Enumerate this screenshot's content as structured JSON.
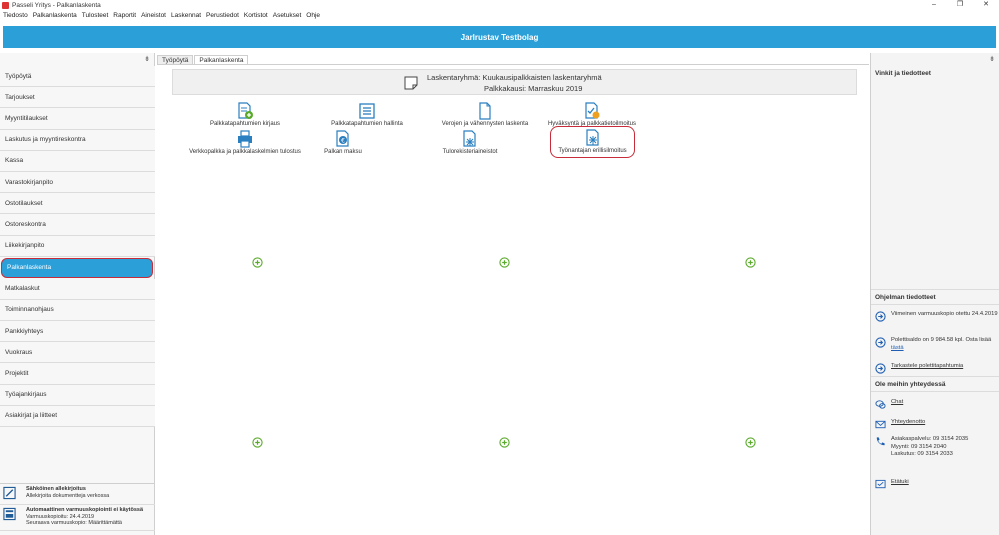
{
  "window": {
    "title": "Passeli Yritys - Palkanlaskenta"
  },
  "menu": [
    "Tiedosto",
    "Palkanlaskenta",
    "Tulosteet",
    "Raportit",
    "Aineistot",
    "Laskennat",
    "Perustiedot",
    "Kortistot",
    "Asetukset",
    "Ohje"
  ],
  "banner": {
    "company": "Jarlrustav Testbolag"
  },
  "sidebar": {
    "items": [
      {
        "label": "Työpöytä"
      },
      {
        "label": "Tarjoukset"
      },
      {
        "label": "Myyntitilaukset"
      },
      {
        "label": "Laskutus ja myyntireskontra"
      },
      {
        "label": "Kassa"
      },
      {
        "label": "Varastokirjanpito"
      },
      {
        "label": "Ostotilaukset"
      },
      {
        "label": "Ostoreskontra"
      },
      {
        "label": "Liikekirjanpito"
      },
      {
        "label": "Palkanlaskenta"
      },
      {
        "label": "Matkalaskut"
      },
      {
        "label": "Toiminnanohjaus"
      },
      {
        "label": "Pankkiyhteys"
      },
      {
        "label": "Vuokraus"
      },
      {
        "label": "Projektit"
      },
      {
        "label": "Työajankirjaus"
      },
      {
        "label": "Asiakirjat ja liitteet"
      }
    ],
    "active_index": 9,
    "bottom": {
      "esign_title": "Sähköinen allekirjoitus",
      "esign_sub": "Allekirjoita dokumentteja verkossa",
      "backup_title": "Automaattinen varmuuskopiointi ei käytössä",
      "backup_line1": "Varmuuskopioitu: 24.4.2019",
      "backup_line2": "Seuraava varmuuskopio: Määrittämättä"
    }
  },
  "tabs": [
    {
      "label": "Työpöytä"
    },
    {
      "label": "Palkanlaskenta"
    }
  ],
  "group": {
    "line1": "Laskentaryhmä: Kuukausipalkkaisten laskentaryhmä",
    "line2": "Palkkakausi: Marraskuu 2019"
  },
  "tiles": {
    "t1": "Palkkatapahtumien kirjaus",
    "t2": "Palkkatapahtumien hallinta",
    "t3": "Verojen ja vähennysten laskenta",
    "t4": "Hyväksyntä ja palkkatietoilmoitus",
    "t5": "Verkkopalkka ja palkkalaskelmien tulostus",
    "t6": "Palkan maksu",
    "t7": "Tulorekisteriaineistot",
    "t8": "Työnantajan erillisilmoitus"
  },
  "right": {
    "tips_title": "Vinkit ja tiedotteet",
    "program_title": "Ohjelman tiedotteet",
    "backup_notice": "Viimeinen varmuuskopio otettu 24.4.2019",
    "tokens_text": "Polettisaldo on 9 984.58 kpl. Osta lisää",
    "tokens_link": "tästä",
    "view_tokens": "Tarkastele polettitapahtumia",
    "contact_title": "Ole meihin yhteydessä",
    "chat": "Chat",
    "contact_form": "Yhteydenotto",
    "service": "Asiakaspalvelu: 09 3154 2035",
    "sales": "Myynti: 09 3154 2040",
    "billing": "Laskutus: 09 3154 2033",
    "remote": "Etätuki"
  },
  "colors": {
    "accent": "#2a9fd8",
    "highlight": "#c62c3a",
    "plus": "#5aaa2a",
    "link": "#1f5fb3"
  }
}
